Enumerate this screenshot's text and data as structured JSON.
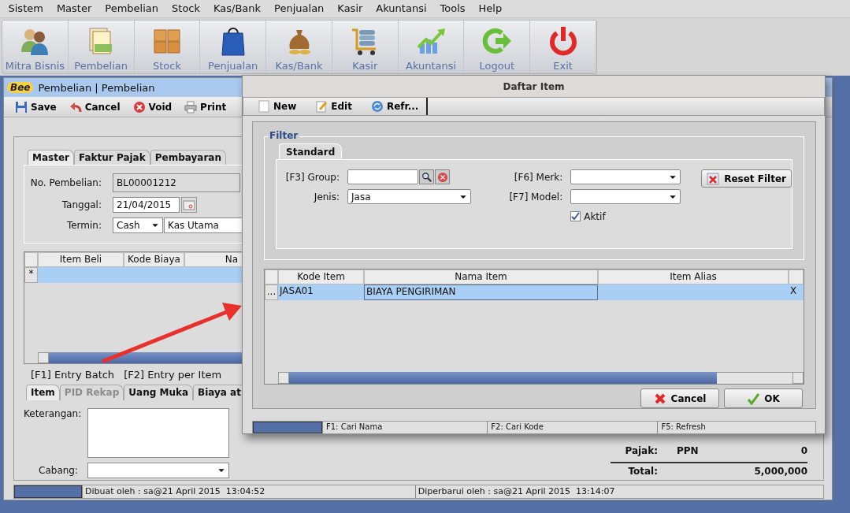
{
  "menu": [
    {
      "label": "Sistem"
    },
    {
      "label": "Master"
    },
    {
      "label": "Pembelian"
    },
    {
      "label": "Stock"
    },
    {
      "label": "Kas/Bank"
    },
    {
      "label": "Penjualan"
    },
    {
      "label": "Kasir"
    },
    {
      "label": "Akuntansi"
    },
    {
      "label": "Tools"
    },
    {
      "label": "Help"
    }
  ],
  "launcher": [
    {
      "label": "Mitra Bisnis",
      "kind": "people"
    },
    {
      "label": "Pembelian",
      "kind": "books"
    },
    {
      "label": "Stock",
      "kind": "boxes"
    },
    {
      "label": "Penjualan",
      "kind": "bag"
    },
    {
      "label": "Kas/Bank",
      "kind": "moneybag"
    },
    {
      "label": "Kasir",
      "kind": "cart"
    },
    {
      "label": "Akuntansi",
      "kind": "chart"
    },
    {
      "label": "Logout",
      "kind": "logout"
    },
    {
      "label": "Exit",
      "kind": "power"
    }
  ],
  "main_window": {
    "logo": "Bee",
    "title": "Pembelian | Pembelian",
    "toolbar": [
      {
        "label": "Save",
        "kind": "save"
      },
      {
        "label": "Cancel",
        "kind": "undo"
      },
      {
        "label": "Void",
        "kind": "void"
      },
      {
        "label": "Print",
        "kind": "print"
      }
    ],
    "tabs": [
      {
        "label": "Master",
        "selected": true
      },
      {
        "label": "Faktur Pajak",
        "selected": false
      },
      {
        "label": "Pembayaran",
        "selected": false
      }
    ],
    "fields": {
      "no_label": "No. Pembelian:",
      "no_value": "BL00001212",
      "tanggal_label": "Tanggal:",
      "tanggal_value": "21/04/2015",
      "termin_label": "Termin:",
      "termin_value": "Cash",
      "kas_value": "Kas Utama"
    },
    "grid": {
      "columns": [
        "Item Beli",
        "Kode Biaya",
        "Na"
      ],
      "rows": [
        {
          "marker": "*",
          "selected": true
        }
      ]
    },
    "shortcuts": [
      "[F1] Entry Batch",
      "[F2] Entry per Item"
    ],
    "lower_tabs": [
      {
        "label": "Item",
        "selected": true,
        "disabled": false
      },
      {
        "label": "PID Rekap",
        "selected": false,
        "disabled": true
      },
      {
        "label": "Uang Muka",
        "selected": false,
        "disabled": false
      },
      {
        "label": "Biaya at",
        "selected": false,
        "disabled": false
      }
    ],
    "keterangan_label": "Keterangan:",
    "cabang_label": "Cabang:",
    "totals": [
      {
        "label": "Pajak:",
        "type": "PPN",
        "value": "0"
      },
      {
        "label": "Total:",
        "value": "5,000,000"
      }
    ],
    "status_bar": [
      "Dibuat oleh : sa@21 April 2015  13:04:52",
      "Diperbarui oleh : sa@21 April 2015  13:14:07"
    ]
  },
  "dialog": {
    "title": "Daftar Item",
    "toolbar": [
      {
        "label": "New",
        "kind": "new"
      },
      {
        "label": "Edit",
        "kind": "edit"
      },
      {
        "label": "Refr...",
        "kind": "refresh"
      }
    ],
    "filter": {
      "title": "Filter",
      "tab": "Standard",
      "group_label": "[F3] Group:",
      "jenis_label": "Jenis:",
      "jenis_value": "Jasa",
      "merk_label": "[F6] Merk:",
      "model_label": "[F7] Model:",
      "aktif": {
        "label": "Aktif",
        "checked": true
      },
      "reset_button": "Reset Filter"
    },
    "table": {
      "columns": [
        "Kode Item",
        "Nama Item",
        "Item Alias"
      ],
      "rows": [
        {
          "row_header": "...",
          "kode_item": "JASA01",
          "nama_item": "BIAYA PENGIRIMAN",
          "column_4": "X",
          "selected": true
        }
      ]
    },
    "buttons": [
      {
        "label": "Cancel",
        "kind": "cancel"
      },
      {
        "label": "OK",
        "kind": "ok"
      }
    ],
    "status_bar": [
      "F1: Cari Nama",
      "F2: Cari Kode",
      "F5: Refresh"
    ]
  }
}
